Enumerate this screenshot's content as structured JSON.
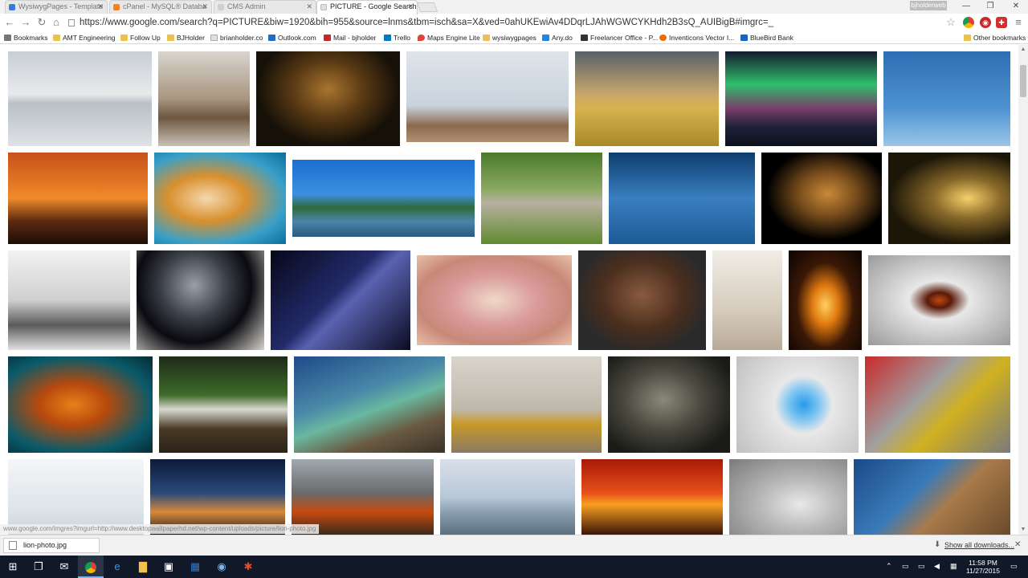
{
  "tabs": [
    {
      "label": "WysiwygPages - Template",
      "favicon_color": "#3a7bd5"
    },
    {
      "label": "cPanel - MySQL® Databa",
      "favicon_color": "#f6821f"
    },
    {
      "label": "CMS Admin",
      "favicon_color": "#aaaaaa"
    },
    {
      "label": "PICTURE - Google Search",
      "favicon_color": "#4285f4"
    }
  ],
  "window_user": "bjholderweb",
  "url": "https://www.google.com/search?q=PICTURE&biw=1920&bih=955&source=lnms&tbm=isch&sa=X&ved=0ahUKEwiAv4DDqrLJAhWGWCYKHdh2B3sQ_AUIBigB#imgrc=_",
  "bookmarks": [
    {
      "label": "Bookmarks",
      "icon": "apps-icon",
      "color": "#666666"
    },
    {
      "label": "AMT Engineering",
      "icon": "folder-icon",
      "color": "#e9c34d"
    },
    {
      "label": "Follow Up",
      "icon": "folder-icon",
      "color": "#e9c34d"
    },
    {
      "label": "BJHolder",
      "icon": "folder-icon",
      "color": "#e9c34d"
    },
    {
      "label": "brianholder.co",
      "icon": "page-icon",
      "color": "#9e9e9e"
    },
    {
      "label": "Outlook.com",
      "icon": "outlook-icon",
      "color": "#1d6fc4"
    },
    {
      "label": "Mail - bjholder",
      "icon": "mail-icon",
      "color": "#c62828"
    },
    {
      "label": "Trello",
      "icon": "trello-icon",
      "color": "#0079bf"
    },
    {
      "label": "Maps Engine Lite",
      "icon": "maps-icon",
      "color": "#db4437"
    },
    {
      "label": "wysiwygpages",
      "icon": "folder-icon",
      "color": "#e9c34d"
    },
    {
      "label": "Any.do",
      "icon": "anydo-icon",
      "color": "#1e88e5"
    },
    {
      "label": "Freelancer Office - P...",
      "icon": "freelancer-icon",
      "color": "#333333"
    },
    {
      "label": "Inventicons Vector I...",
      "icon": "inventicons-icon",
      "color": "#ef6c00"
    },
    {
      "label": "BlueBird Bank",
      "icon": "bank-icon",
      "color": "#1565c0"
    }
  ],
  "other_bookmarks": "Other bookmarks",
  "status_url": "www.google.com/imgres?imgurl=http://www.desktopwallpaperhd.net/wp-content/uploads/picture/lion-photo.jpg",
  "download": {
    "filename": "lion-photo.jpg",
    "show_all": "Show all downloads..."
  },
  "taskbar": {
    "time": "11:58 PM",
    "date": "11/27/2015"
  }
}
